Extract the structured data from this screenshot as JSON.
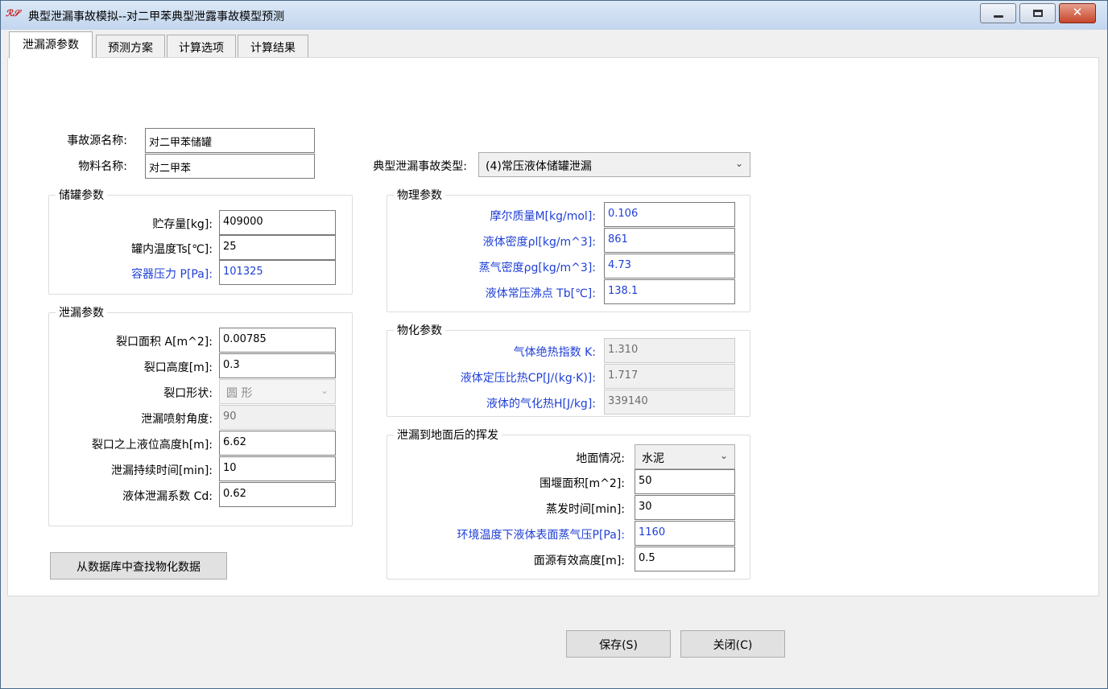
{
  "window": {
    "title": "典型泄漏事故模拟--对二甲苯典型泄露事故模型预测",
    "app_icon_text": "ℛ𝒮",
    "icons": {
      "app": "rs-logo-icon",
      "minimize": "minimize-icon",
      "maximize": "maximize-icon",
      "close": "close-icon"
    }
  },
  "tabs": [
    {
      "label": "泄漏源参数",
      "active": true
    },
    {
      "label": "预测方案",
      "active": false
    },
    {
      "label": "计算选项",
      "active": false
    },
    {
      "label": "计算结果",
      "active": false
    }
  ],
  "source": {
    "name_label": "事故源名称:",
    "name_value": "对二甲苯储罐",
    "material_label": "物料名称:",
    "material_value": "对二甲苯",
    "type_label": "典型泄漏事故类型:",
    "type_value": "(4)常压液体储罐泄漏"
  },
  "tank": {
    "title": "储罐参数",
    "fields": [
      {
        "label": "贮存量[kg]:",
        "value": "409000"
      },
      {
        "label": "罐内温度Ts[℃]:",
        "value": "25"
      },
      {
        "label": "容器压力 P[Pa]:",
        "value": "101325"
      }
    ]
  },
  "leak": {
    "title": "泄漏参数",
    "area_label": "裂口面积 A[m^2]:",
    "area_value": "0.00785",
    "height_label": "裂口高度[m]:",
    "height_value": "0.3",
    "shape_label": "裂口形状:",
    "shape_value": "圆 形",
    "angle_label": "泄漏喷射角度:",
    "angle_value": "90",
    "level_label": "裂口之上液位高度h[m]:",
    "level_value": "6.62",
    "duration_label": "泄漏持续时间[min]:",
    "duration_value": "10",
    "cd_label": "液体泄漏系数 Cd:",
    "cd_value": "0.62"
  },
  "physical": {
    "title": "物理参数",
    "fields": [
      {
        "label": "摩尔质量M[kg/mol]:",
        "value": "0.106"
      },
      {
        "label": "液体密度ρl[kg/m^3]:",
        "value": "861"
      },
      {
        "label": "蒸气密度ρg[kg/m^3]:",
        "value": "4.73"
      },
      {
        "label": "液体常压沸点 Tb[℃]:",
        "value": "138.1"
      }
    ]
  },
  "chemical": {
    "title": "物化参数",
    "fields": [
      {
        "label": "气体绝热指数 K:",
        "value": "1.310"
      },
      {
        "label": "液体定压比热CP[J/(kg·K)]:",
        "value": "1.717"
      },
      {
        "label": "液体的气化热H[J/kg]:",
        "value": "339140"
      }
    ]
  },
  "evaporation": {
    "title": "泄漏到地面后的挥发",
    "ground_label": "地面情况:",
    "ground_value": "水泥",
    "dike_label": "围堰面积[m^2]:",
    "dike_value": "50",
    "time_label": "蒸发时间[min]:",
    "time_value": "30",
    "vapor_label": "环境温度下液体表面蒸气压P[Pa]:",
    "vapor_value": "1160",
    "height_label": "面源有效高度[m]:",
    "height_value": "0.5"
  },
  "buttons": {
    "lookup": "从数据库中查找物化数据",
    "save": "保存(S)",
    "close": "关闭(C)"
  },
  "colors": {
    "blue_label": "#1f3fd6",
    "title_bar": "#c3d6ee",
    "close_button": "#c7452b"
  }
}
